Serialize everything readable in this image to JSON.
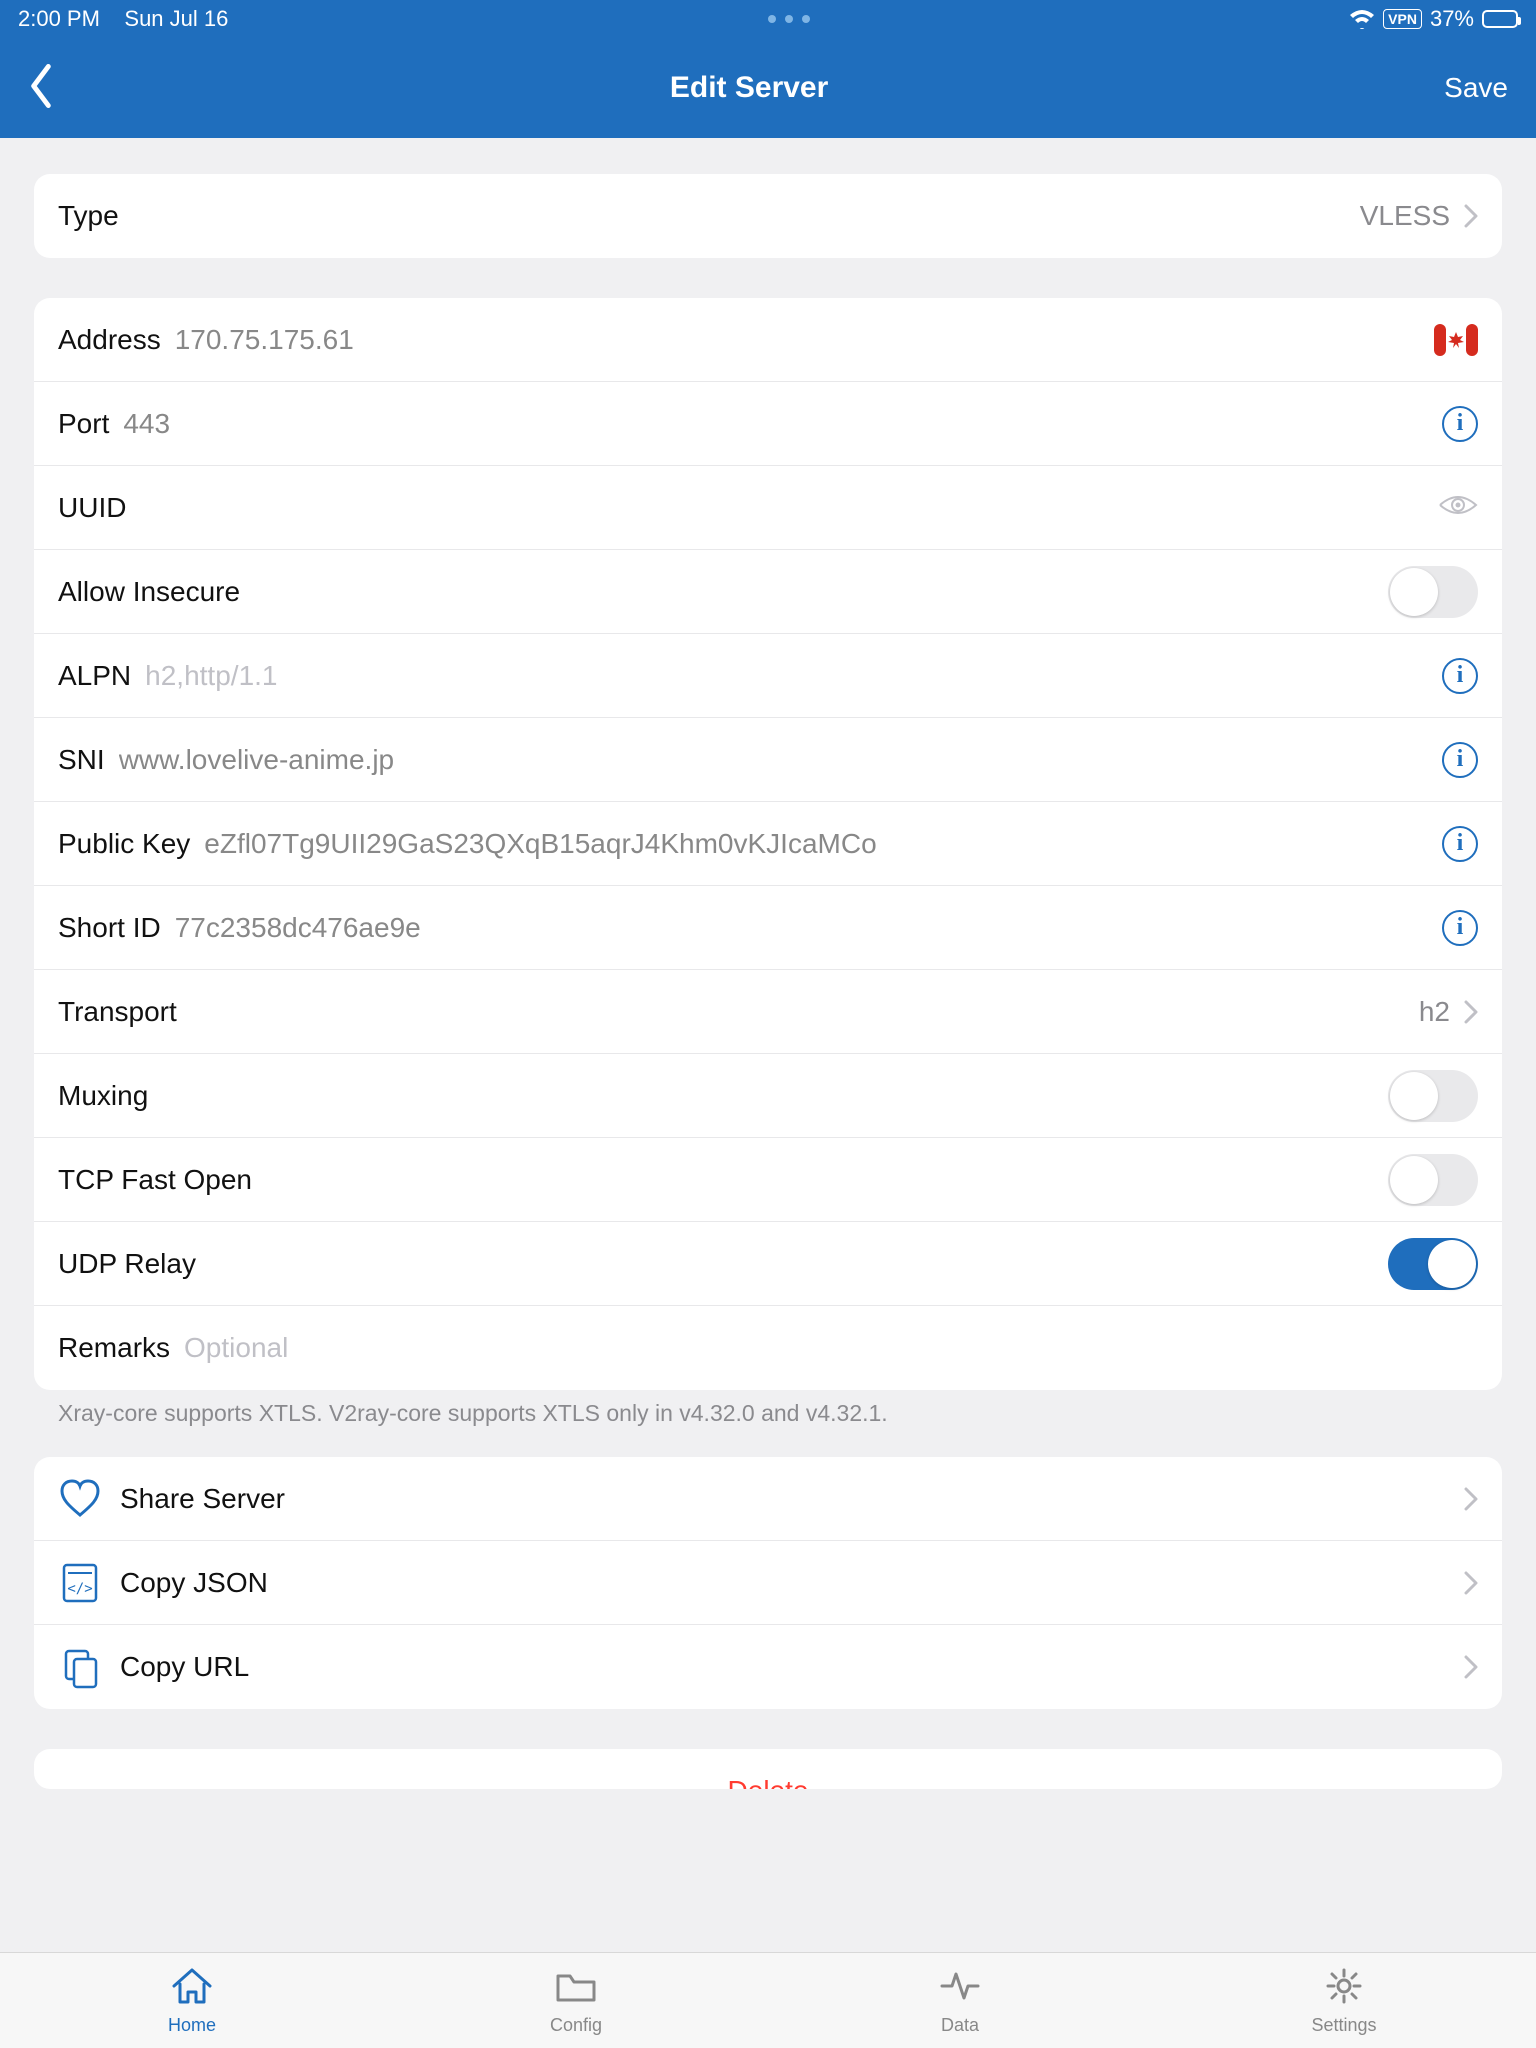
{
  "status": {
    "time": "2:00 PM",
    "date": "Sun Jul 16",
    "vpn": "VPN",
    "battery": "37%"
  },
  "nav": {
    "title": "Edit Server",
    "save": "Save"
  },
  "type": {
    "label": "Type",
    "value": "VLESS"
  },
  "fields": {
    "address": {
      "label": "Address",
      "value": "170.75.175.61"
    },
    "port": {
      "label": "Port",
      "value": "443"
    },
    "uuid": {
      "label": "UUID",
      "value": ""
    },
    "allow_insecure": {
      "label": "Allow Insecure"
    },
    "alpn": {
      "label": "ALPN",
      "placeholder": "h2,http/1.1"
    },
    "sni": {
      "label": "SNI",
      "value": "www.lovelive-anime.jp"
    },
    "public_key": {
      "label": "Public Key",
      "value": "eZfl07Tg9UII29GaS23QXqB15aqrJ4Khm0vKJIcaMCo"
    },
    "short_id": {
      "label": "Short ID",
      "value": "77c2358dc476ae9e"
    },
    "transport": {
      "label": "Transport",
      "value": "h2"
    },
    "muxing": {
      "label": "Muxing"
    },
    "tcp_fast_open": {
      "label": "TCP Fast Open"
    },
    "udp_relay": {
      "label": "UDP Relay"
    },
    "remarks": {
      "label": "Remarks",
      "placeholder": "Optional"
    }
  },
  "note": "Xray-core supports XTLS. V2ray-core supports XTLS only in v4.32.0 and v4.32.1.",
  "actions": {
    "share": "Share Server",
    "copy_json": "Copy JSON",
    "copy_url": "Copy URL"
  },
  "delete": "Delete",
  "tabs": {
    "home": "Home",
    "config": "Config",
    "data": "Data",
    "settings": "Settings"
  }
}
